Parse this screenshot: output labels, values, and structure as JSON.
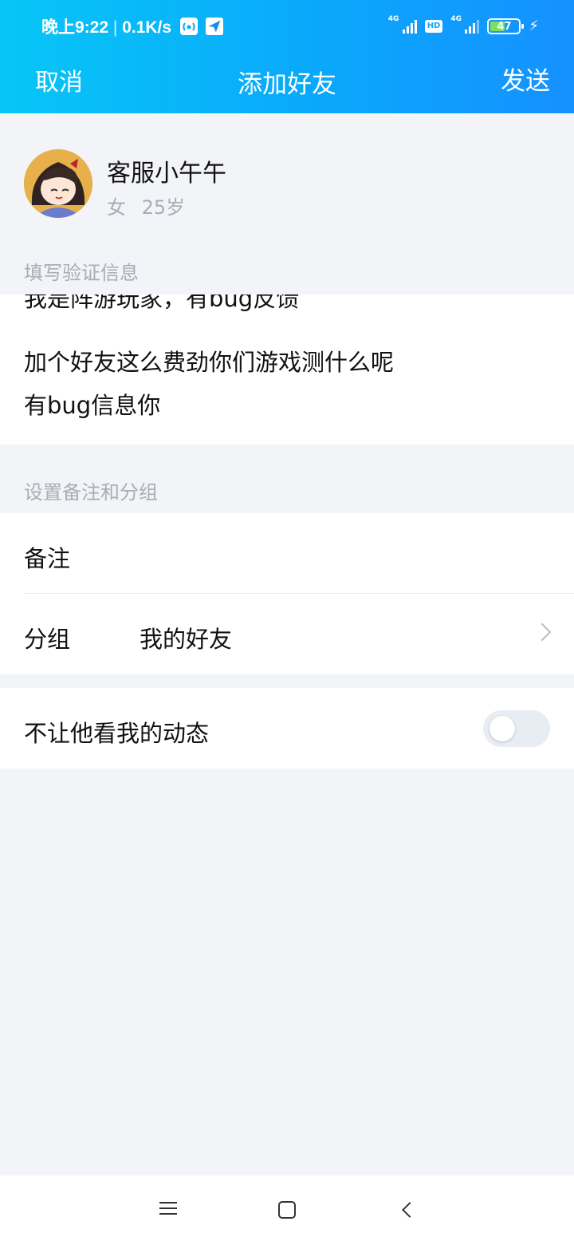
{
  "status_bar": {
    "time": "晚上9:22",
    "separator": "|",
    "net_speed": "0.1K/s",
    "signal1_tag": "4G",
    "hd_badge": "HD",
    "signal2_tag": "4G",
    "battery": "47",
    "charging_icon": "bolt-icon"
  },
  "nav": {
    "cancel": "取消",
    "title": "添加好友",
    "send": "发送"
  },
  "profile": {
    "name": "客服小午午",
    "gender": "女",
    "age": "25岁"
  },
  "verification": {
    "label": "填写验证信息",
    "lines": [
      "我是阵游玩家，有bug反馈",
      "加个好友这么费劲你们游戏测什么呢",
      "有bug信息你"
    ]
  },
  "remark_group": {
    "label": "设置备注和分组",
    "remark_label": "备注",
    "remark_value": "",
    "group_label": "分组",
    "group_value": "我的好友"
  },
  "privacy": {
    "label": "不让他看我的动态",
    "enabled": false
  },
  "colors": {
    "header_start": "#07c6f6",
    "header_end": "#1591ff",
    "background": "#f3f4f8"
  }
}
